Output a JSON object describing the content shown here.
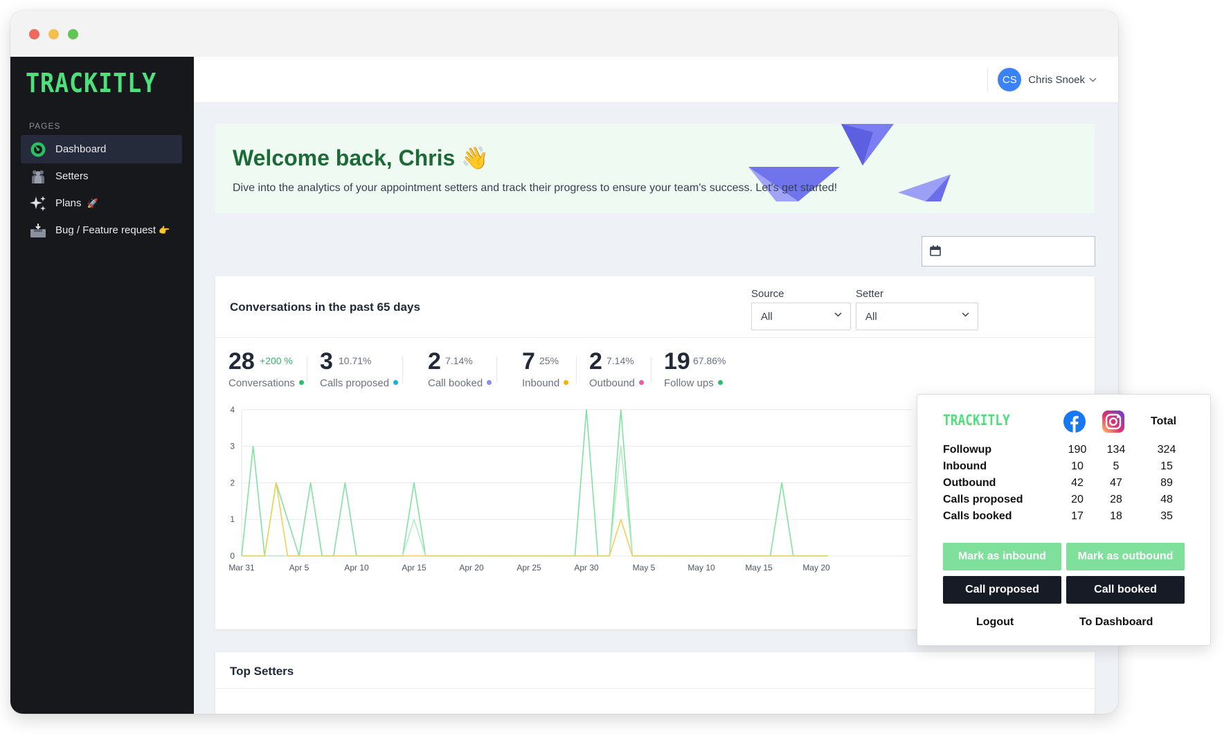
{
  "app": {
    "logo_text": "TRACKITLY"
  },
  "sidebar": {
    "section_label": "PAGES",
    "items": [
      {
        "label": "Dashboard",
        "icon": "dashboard-icon",
        "emoji": ""
      },
      {
        "label": "Setters",
        "icon": "setters-icon",
        "emoji": ""
      },
      {
        "label": "Plans",
        "icon": "sparkles-icon",
        "emoji": "🚀"
      },
      {
        "label": "Bug / Feature request",
        "icon": "inbox-icon",
        "emoji": "👉"
      }
    ]
  },
  "header": {
    "user_initials": "CS",
    "user_name": "Chris Snoek"
  },
  "welcome": {
    "title": "Welcome back, Chris 👋",
    "subtitle": "Dive into the analytics of your appointment setters and track their progress to ensure your team's success. Let's get started!"
  },
  "conversations": {
    "title": "Conversations in the past 65 days",
    "source_label": "Source",
    "source_value": "All",
    "setter_label": "Setter",
    "setter_value": "All",
    "stats": [
      {
        "value": "28",
        "pct": "+200 %",
        "label": "Conversations",
        "color": "#2ebd6b"
      },
      {
        "value": "3",
        "pct": "10.71%",
        "label": "Calls proposed",
        "color": "#17b3d4"
      },
      {
        "value": "2",
        "pct": "7.14%",
        "label": "Call booked",
        "color": "#8b8df0"
      },
      {
        "value": "7",
        "pct": "25%",
        "label": "Inbound",
        "color": "#f5b400"
      },
      {
        "value": "2",
        "pct": "7.14%",
        "label": "Outbound",
        "color": "#ef5b9c"
      },
      {
        "value": "19",
        "pct": "67.86%",
        "label": "Follow ups",
        "color": "#2ebd6b"
      }
    ]
  },
  "chart_data": {
    "type": "line",
    "y_ticks": [
      "0",
      "1",
      "2",
      "3",
      "4"
    ],
    "ylim": [
      0,
      4
    ],
    "x_tick_labels": [
      "Mar 31",
      "Apr 5",
      "Apr 10",
      "Apr 15",
      "Apr 20",
      "Apr 25",
      "Apr 30",
      "May 5",
      "May 10",
      "May 15",
      "May 20"
    ],
    "x_days": 52,
    "grid": true,
    "series": [
      {
        "color": "#7fe3a0",
        "values": [
          0,
          3,
          0,
          2,
          1,
          0,
          2,
          0,
          0,
          2,
          0,
          0,
          0,
          0,
          0,
          2,
          0,
          0,
          0,
          0,
          0,
          0,
          0,
          0,
          0,
          0,
          0,
          0,
          0,
          0,
          4,
          0,
          0,
          4,
          0,
          0,
          0,
          0,
          0,
          0,
          0,
          0,
          0,
          0,
          0,
          0,
          0,
          2,
          0,
          0,
          0,
          0
        ]
      },
      {
        "color": "#b3ecc5",
        "values": [
          0,
          0,
          0,
          0,
          0,
          0,
          0,
          0,
          0,
          0,
          0,
          0,
          0,
          0,
          0,
          1,
          0,
          0,
          0,
          0,
          0,
          0,
          0,
          0,
          0,
          0,
          0,
          0,
          0,
          0,
          0,
          0,
          0,
          3,
          0,
          0,
          0,
          0,
          0,
          0,
          0,
          0,
          0,
          0,
          0,
          0,
          0,
          0,
          0,
          0,
          0,
          0
        ]
      },
      {
        "color": "#f5cf55",
        "values": [
          0,
          0,
          0,
          2,
          0,
          0,
          0,
          0,
          0,
          0,
          0,
          0,
          0,
          0,
          0,
          0,
          0,
          0,
          0,
          0,
          0,
          0,
          0,
          0,
          0,
          0,
          0,
          0,
          0,
          0,
          0,
          0,
          0,
          1,
          0,
          0,
          0,
          0,
          0,
          0,
          0,
          0,
          0,
          0,
          0,
          0,
          0,
          0,
          0,
          0,
          0,
          0
        ]
      }
    ]
  },
  "top_setters": {
    "title": "Top Setters"
  },
  "popup": {
    "logo_text": "TRACKITLY",
    "facebook_icon": "facebook-icon",
    "instagram_icon": "instagram-icon",
    "total_label": "Total",
    "rows": [
      {
        "label": "Followup",
        "fb": "190",
        "ig": "134",
        "total": "324"
      },
      {
        "label": "Inbound",
        "fb": "10",
        "ig": "5",
        "total": "15"
      },
      {
        "label": "Outbound",
        "fb": "42",
        "ig": "47",
        "total": "89"
      },
      {
        "label": "Calls proposed",
        "fb": "20",
        "ig": "28",
        "total": "48"
      },
      {
        "label": "Calls booked",
        "fb": "17",
        "ig": "18",
        "total": "35"
      }
    ],
    "mark_inbound": "Mark as inbound",
    "mark_outbound": "Mark as outbound",
    "call_proposed": "Call proposed",
    "call_booked": "Call booked",
    "logout": "Logout",
    "to_dashboard": "To Dashboard"
  }
}
